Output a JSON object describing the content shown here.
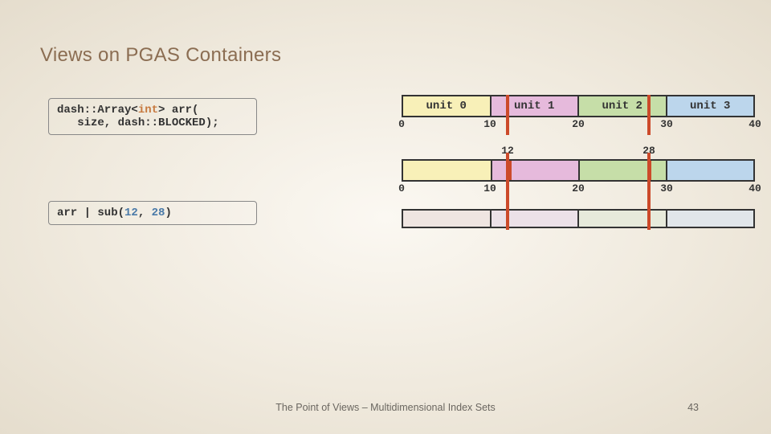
{
  "title": "Views on PGAS Containers",
  "code1_l1_a": "dash::Array<",
  "code1_l1_b": "int",
  "code1_l1_c": "> arr(",
  "code1_l2": "   size, dash::BLOCKED);",
  "code2_a": "arr | sub(",
  "code2_b": "12",
  "code2_c": ", ",
  "code2_d": "28",
  "code2_e": ")",
  "units": [
    "unit 0",
    "unit 1",
    "unit 2",
    "unit 3"
  ],
  "ticks_top": [
    "0",
    "10",
    "20",
    "30",
    "40"
  ],
  "range_lo": "12",
  "range_hi": "28",
  "ticks_row2": [
    "0",
    "10",
    "20",
    "30",
    "40"
  ],
  "footer": "The Point of Views – Multidimensional Index Sets",
  "slide_number": "43",
  "chart_data": {
    "type": "table",
    "description": "PGAS blocked 1D array of 40 elements over 4 units, view sub(12,28)",
    "array_size": 40,
    "units": [
      {
        "name": "unit 0",
        "range": [
          0,
          10
        ],
        "color": "#f8f0b8"
      },
      {
        "name": "unit 1",
        "range": [
          10,
          20
        ],
        "color": "#e6badc"
      },
      {
        "name": "unit 2",
        "range": [
          20,
          30
        ],
        "color": "#c6dea8"
      },
      {
        "name": "unit 3",
        "range": [
          30,
          40
        ],
        "color": "#bcd6ec"
      }
    ],
    "global_ticks": [
      0,
      10,
      20,
      30,
      40
    ],
    "sub_view": {
      "begin": 12,
      "end": 28
    },
    "sub_view_segments": [
      {
        "range": [
          0,
          10
        ],
        "color": "#f8f0b8",
        "covered": false
      },
      {
        "range": [
          10,
          12
        ],
        "color": "#e6badc",
        "covered": false
      },
      {
        "range": [
          12,
          20
        ],
        "color": "#e6badc",
        "covered": true
      },
      {
        "range": [
          20,
          28
        ],
        "color": "#c6dea8",
        "covered": true
      },
      {
        "range": [
          28,
          30
        ],
        "color": "#c6dea8",
        "covered": false
      },
      {
        "range": [
          30,
          40
        ],
        "color": "#bcd6ec",
        "covered": false
      }
    ]
  }
}
